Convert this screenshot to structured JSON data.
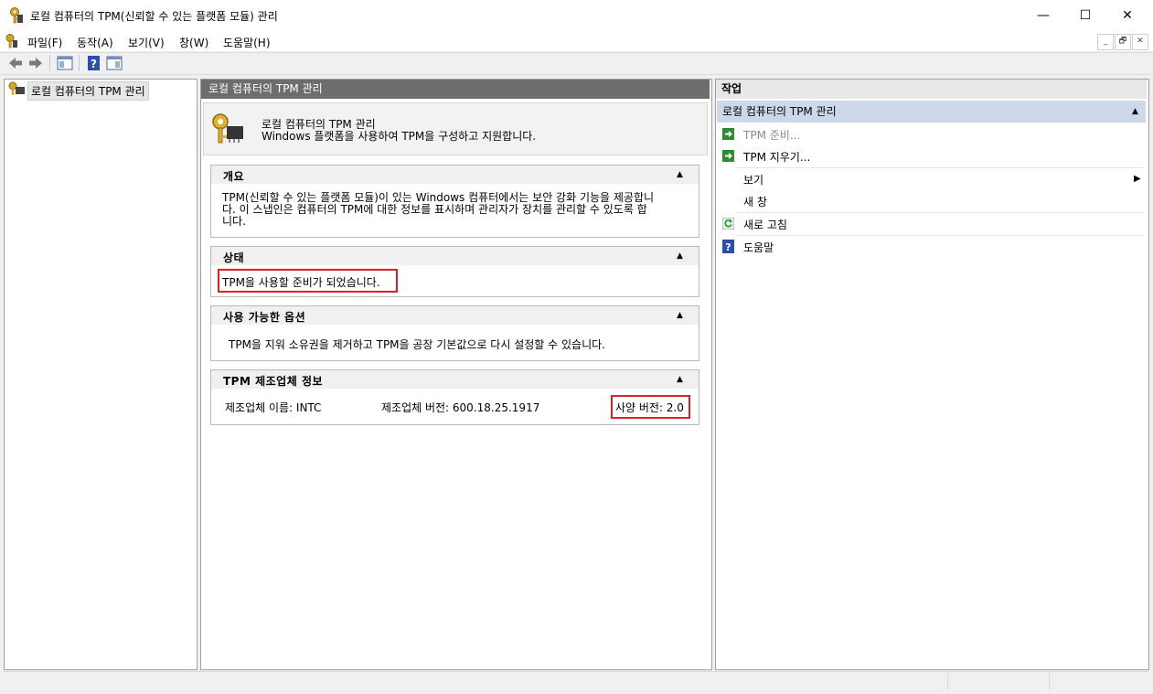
{
  "window": {
    "title": "로컬 컴퓨터의 TPM(신뢰할 수 있는 플랫폼 모듈) 관리",
    "minimize": "—",
    "maximize": "☐",
    "close": "✕"
  },
  "menu": {
    "items": [
      "파일(F)",
      "동작(A)",
      "보기(V)",
      "창(W)",
      "도움말(H)"
    ],
    "mdi": [
      "_",
      "🗗",
      "✕"
    ]
  },
  "tree": {
    "root_label": "로컬 컴퓨터의 TPM 관리"
  },
  "center": {
    "header": "로컬 컴퓨터의 TPM 관리",
    "banner_title": "로컬 컴퓨터의 TPM 관리",
    "banner_desc": "Windows 플랫폼을 사용하여 TPM을 구성하고 지원합니다.",
    "overview": {
      "title": "개요",
      "line1": "TPM(신뢰할 수 있는 플랫폼 모듈)이 있는 Windows 컴퓨터에서는 보안 강화 기능을 제공합니",
      "line2": "다. 이 스냅인은 컴퓨터의 TPM에 대한 정보를 표시하며 관리자가 장치를 관리할 수 있도록 합",
      "line3": "니다."
    },
    "status": {
      "title": "상태",
      "text": "TPM을 사용할 준비가 되었습니다."
    },
    "options": {
      "title": "사용 가능한 옵션",
      "text": "TPM을 지워 소유권을 제거하고 TPM을 공장 기본값으로 다시 설정할 수 있습니다."
    },
    "manufacturer": {
      "title": "TPM 제조업체 정보",
      "name": "제조업체 이름: INTC",
      "version": "제조업체 버전: 600.18.25.1917",
      "spec": "사양 버전: 2.0"
    }
  },
  "actions": {
    "header": "작업",
    "group": "로컬 컴퓨터의 TPM 관리",
    "items": {
      "prepare": "TPM 준비...",
      "clear": "TPM 지우기...",
      "view": "보기",
      "new_window": "새 창",
      "refresh": "새로 고침",
      "help": "도움말"
    }
  },
  "colors": {
    "highlight_box": "#e01f26",
    "center_header": "#6d6d6d",
    "actions_group": "#cbd9ea",
    "action_green": "#2e8b2e",
    "help_blue": "#2a4fb0"
  }
}
